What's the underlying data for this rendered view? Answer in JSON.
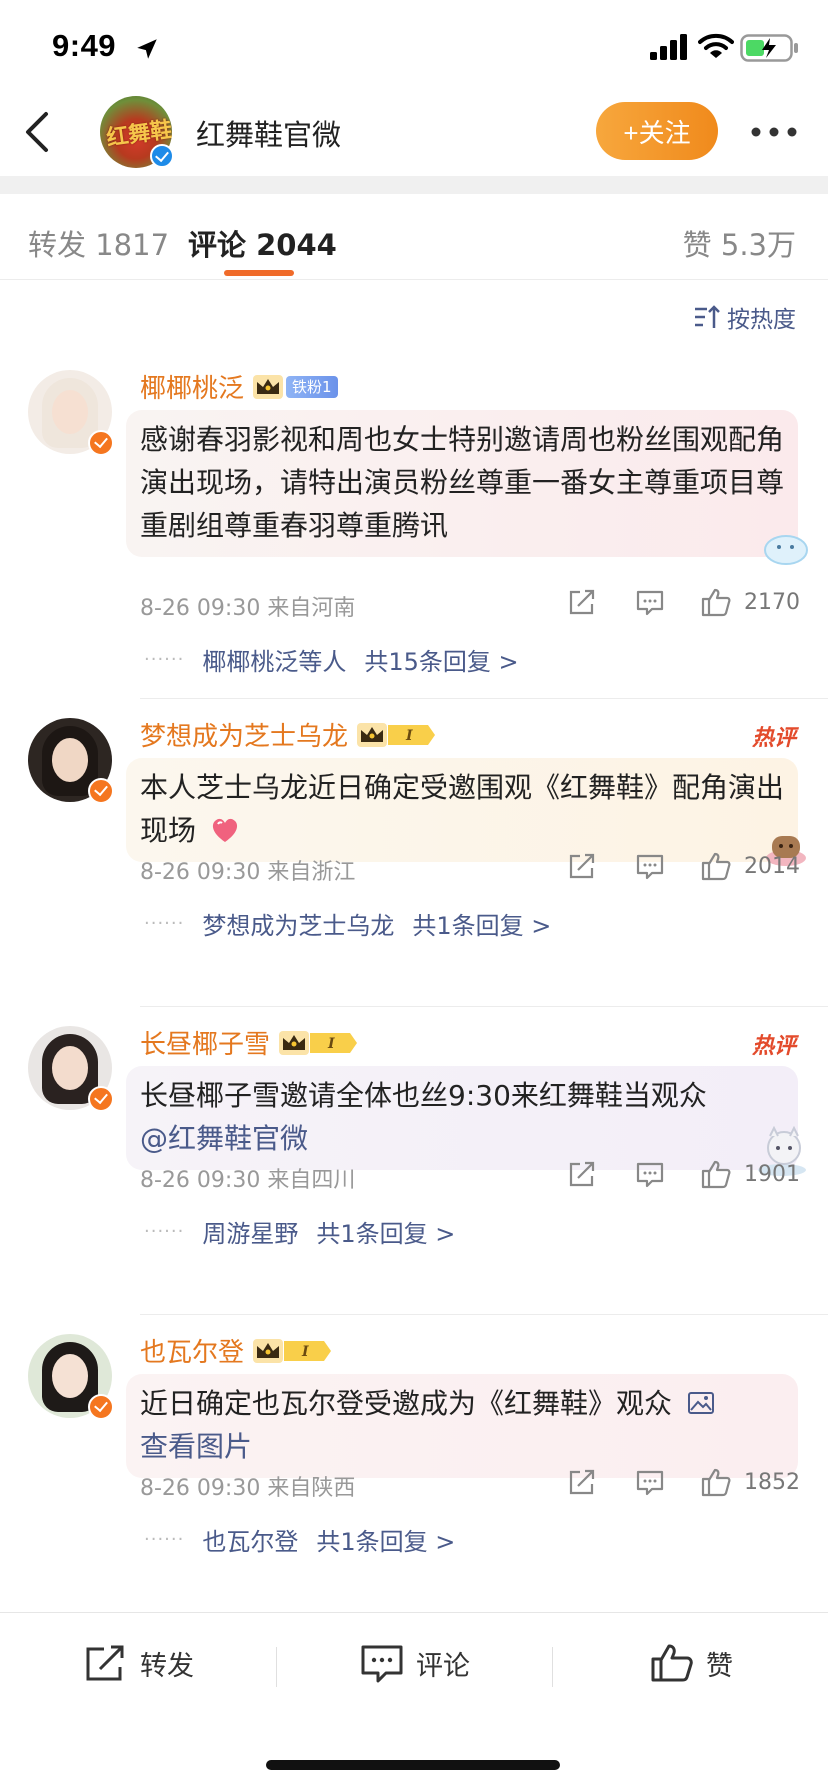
{
  "status_bar": {
    "time": "9:49"
  },
  "nav": {
    "avatar_text": "红舞鞋",
    "title": "红舞鞋官微",
    "follow_label": "+关注"
  },
  "tabs": {
    "repost": "转发 1817",
    "comment": "评论 2044",
    "like": "赞 5.3万"
  },
  "sort_label": "按热度",
  "comments": [
    {
      "name": "椰椰桃泛",
      "fan_badge": "铁粉1",
      "hot_tag": "",
      "text": "感谢春羽影视和周也女士特别邀请周也粉丝围观配角演出现场，请特出演员粉丝尊重一番女主尊重项目尊重剧组尊重春羽尊重腾讯",
      "time": "8-26 09:30 来自河南",
      "likes": "2170",
      "reply_who": "椰椰桃泛等人",
      "reply_count": "共15条回复 >"
    },
    {
      "name": "梦想成为芝士乌龙",
      "fan_badge": "",
      "hot_tag": "热评",
      "text": "本人芝士乌龙近日确定受邀围观《红舞鞋》配角演出现场",
      "time": "8-26 09:30 来自浙江",
      "likes": "2014",
      "reply_who": "梦想成为芝士乌龙",
      "reply_count": "共1条回复 >"
    },
    {
      "name": "长昼椰子雪",
      "fan_badge": "",
      "hot_tag": "热评",
      "text": "长昼椰子雪邀请全体也丝9:30来红舞鞋当观众",
      "mention": "@红舞鞋官微",
      "time": "8-26 09:30 来自四川",
      "likes": "1901",
      "reply_who": "周游星野",
      "reply_count": "共1条回复 >"
    },
    {
      "name": "也瓦尔登",
      "fan_badge": "",
      "hot_tag": "",
      "text": "近日确定也瓦尔登受邀成为《红舞鞋》观众",
      "link": "查看图片",
      "time": "8-26 09:30 来自陕西",
      "likes": "1852",
      "reply_who": "也瓦尔登",
      "reply_count": "共1条回复 >"
    }
  ],
  "bottom_bar": {
    "repost": "转发",
    "comment": "评论",
    "like": "赞"
  },
  "colors": {
    "accent": "#f08a1c",
    "username": "#e4781f",
    "link": "#4a5a8a",
    "hot": "#e34b2c"
  }
}
